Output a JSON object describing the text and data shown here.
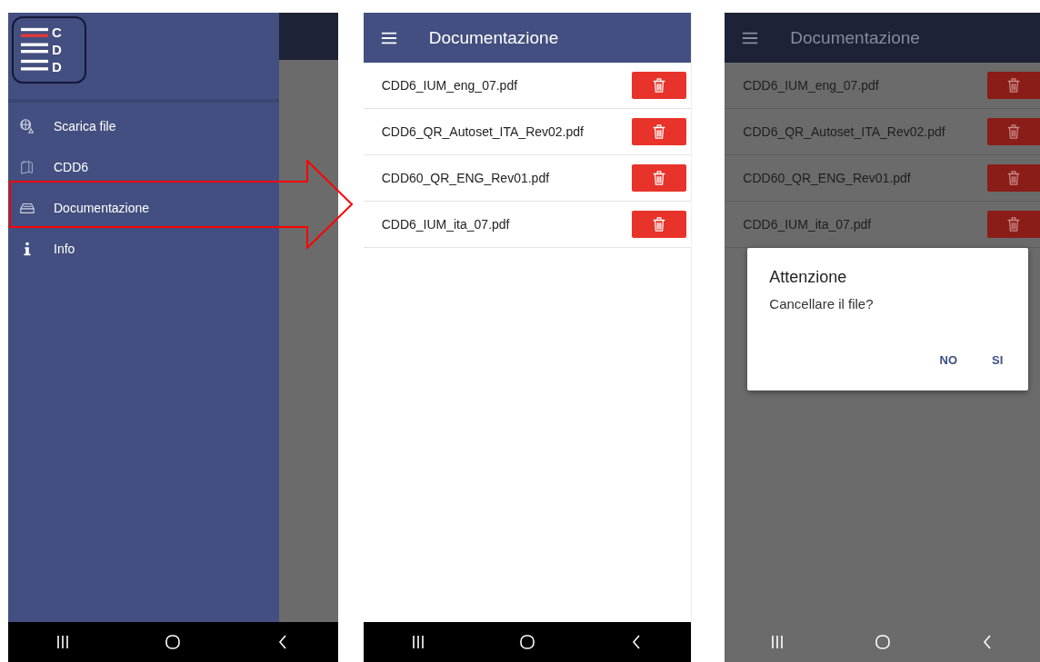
{
  "drawer_screen": {
    "logo_letters": [
      "C",
      "D",
      "D"
    ],
    "items": [
      {
        "kind": "globe",
        "label": "Scarica file"
      },
      {
        "kind": "box",
        "label": "CDD6"
      },
      {
        "kind": "tray",
        "label": "Documentazione"
      },
      {
        "kind": "info",
        "label": "Info"
      }
    ]
  },
  "list_screen": {
    "title": "Documentazione",
    "files": [
      "CDD6_IUM_eng_07.pdf",
      "CDD6_QR_Autoset_ITA_Rev02.pdf",
      "CDD60_QR_ENG_Rev01.pdf",
      "CDD6_IUM_ita_07.pdf"
    ]
  },
  "dialog_screen": {
    "title": "Documentazione",
    "files": [
      "CDD6_IUM_eng_07.pdf",
      "CDD6_QR_Autoset_ITA_Rev02.pdf",
      "CDD60_QR_ENG_Rev01.pdf",
      "CDD6_IUM_ita_07.pdf"
    ],
    "dialog": {
      "title": "Attenzione",
      "message": "Cancellare il file?",
      "buttons": [
        "NO",
        "SI"
      ]
    }
  }
}
